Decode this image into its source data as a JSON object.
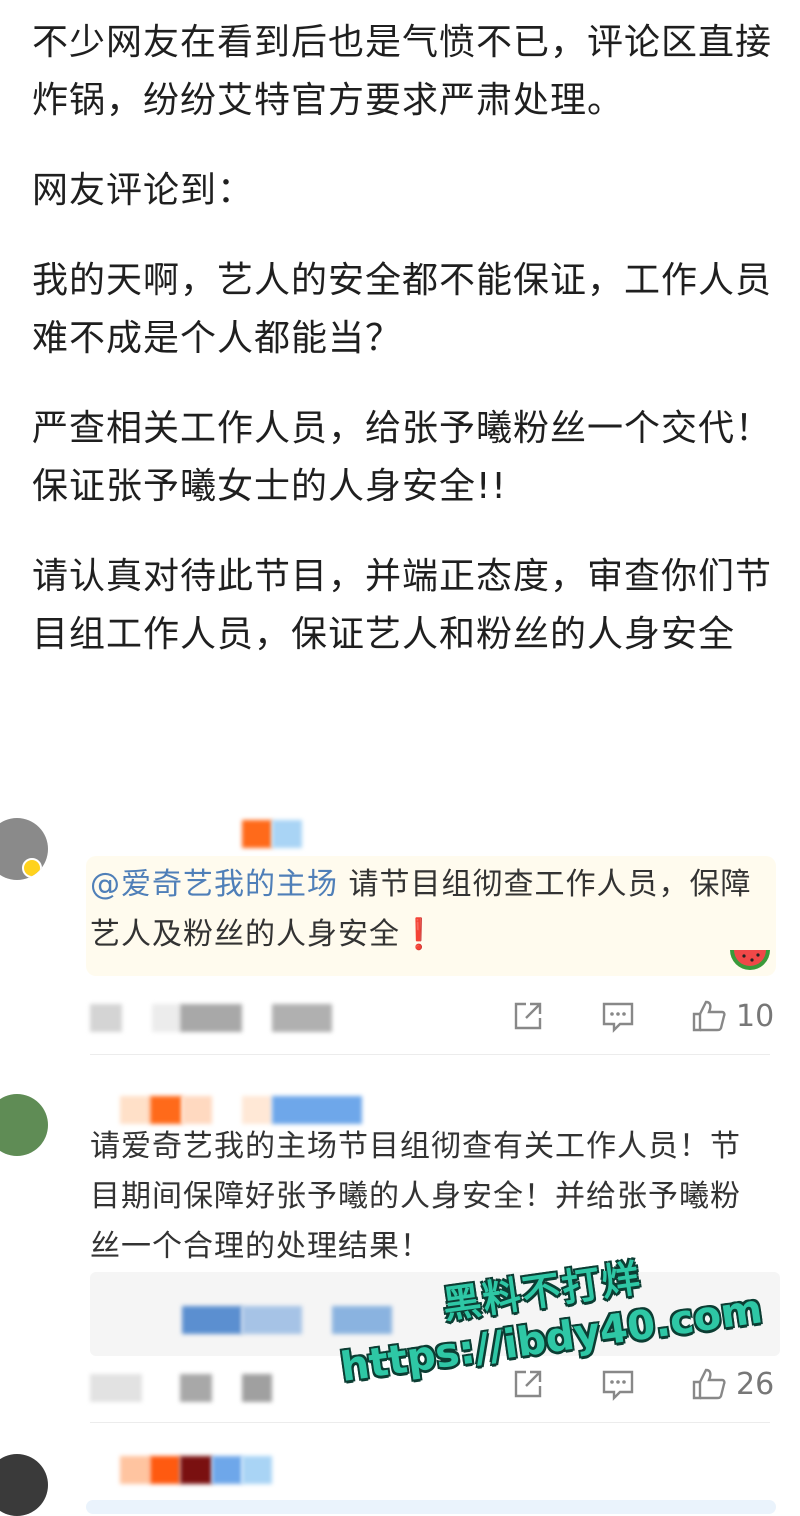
{
  "article": {
    "paragraphs": [
      "不少网友在看到后也是气愤不已，评论区直接炸锅，纷纷艾特官方要求严肃处理。",
      "网友评论到：",
      "我的天啊，艺人的安全都不能保证，工作人员难不成是个人都能当？",
      "严查相关工作人员，给张予曦粉丝一个交代！保证张予曦女士的人身安全!!",
      "请认真对待此节目，并端正态度，审查你们节目组工作人员，保证艺人和粉丝的人身安全"
    ]
  },
  "comments": [
    {
      "mention": "@爱奇艺我的主场",
      "text": " 请节目组彻查工作人员，保障艺人及粉丝的人身安全",
      "exclaim": "❗",
      "likes": "10"
    },
    {
      "text": "请爱奇艺我的主场节目组彻查有关工作人员！节目期间保障好张予曦的人身安全！并给张予曦粉丝一个合理的处理结果！",
      "likes": "26"
    }
  ],
  "watermark": {
    "line1": "黑料不打烊",
    "line2": "https://ibdy40.com"
  },
  "icons": [
    "share-icon",
    "comment-icon",
    "like-icon",
    "watermelon-icon"
  ]
}
